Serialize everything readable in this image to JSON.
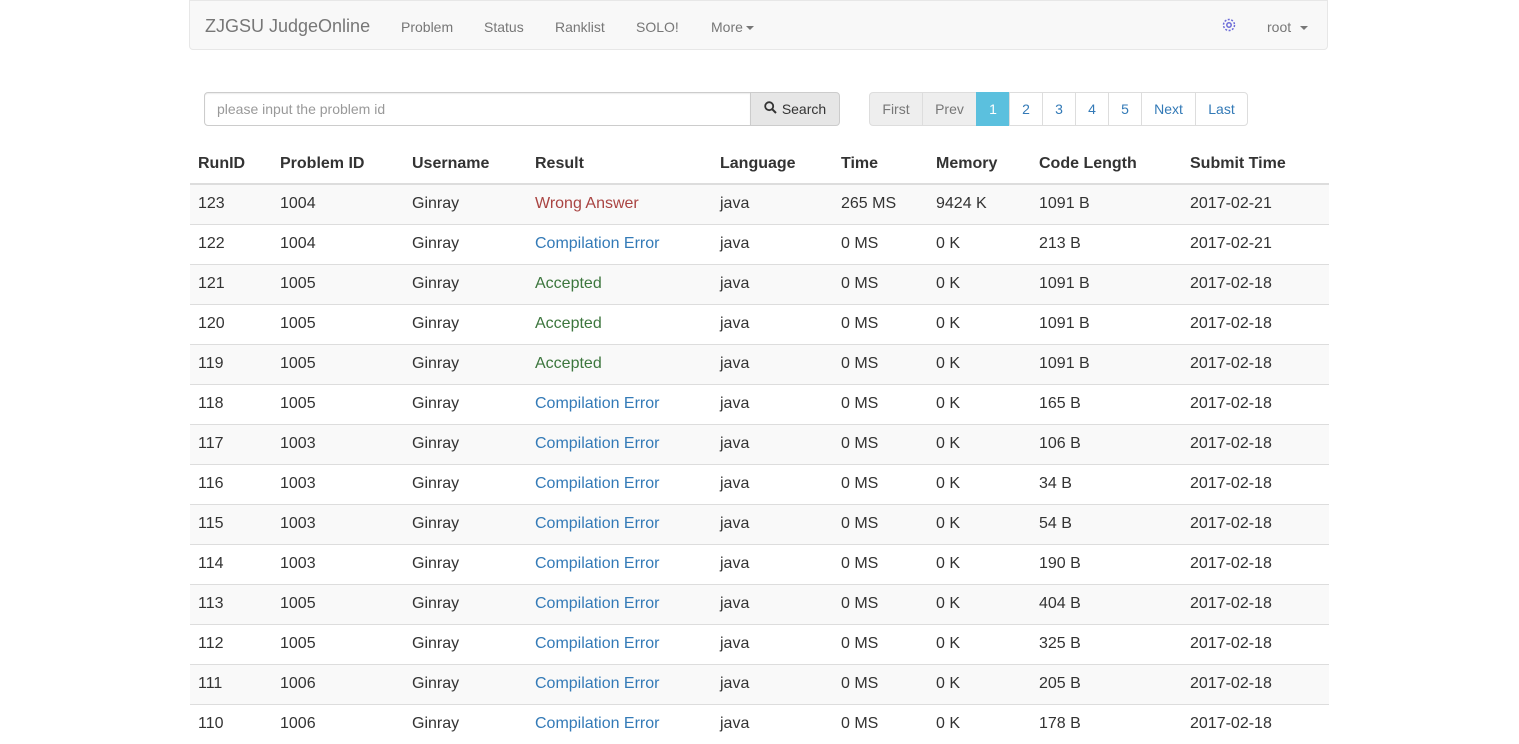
{
  "navbar": {
    "brand": "ZJGSU JudgeOnline",
    "links": [
      "Problem",
      "Status",
      "Ranklist",
      "SOLO!",
      "More"
    ],
    "user": "root",
    "gear_icon": "gear-icon"
  },
  "search": {
    "placeholder": "please input the problem id",
    "value": "",
    "button_label": "Search",
    "icon": "search-icon"
  },
  "pagination": [
    "First",
    "Prev",
    "1",
    "2",
    "3",
    "4",
    "5",
    "Next",
    "Last"
  ],
  "pagination_active": "1",
  "table": {
    "headers": [
      "RunID",
      "Problem ID",
      "Username",
      "Result",
      "Language",
      "Time",
      "Memory",
      "Code Length",
      "Submit Time"
    ],
    "rows": [
      [
        "123",
        "1004",
        "Ginray",
        "Wrong Answer",
        "java",
        "265 MS",
        "9424 K",
        "1091 B",
        "2017-02-21"
      ],
      [
        "122",
        "1004",
        "Ginray",
        "Compilation Error",
        "java",
        "0 MS",
        "0 K",
        "213 B",
        "2017-02-21"
      ],
      [
        "121",
        "1005",
        "Ginray",
        "Accepted",
        "java",
        "0 MS",
        "0 K",
        "1091 B",
        "2017-02-18"
      ],
      [
        "120",
        "1005",
        "Ginray",
        "Accepted",
        "java",
        "0 MS",
        "0 K",
        "1091 B",
        "2017-02-18"
      ],
      [
        "119",
        "1005",
        "Ginray",
        "Accepted",
        "java",
        "0 MS",
        "0 K",
        "1091 B",
        "2017-02-18"
      ],
      [
        "118",
        "1005",
        "Ginray",
        "Compilation Error",
        "java",
        "0 MS",
        "0 K",
        "165 B",
        "2017-02-18"
      ],
      [
        "117",
        "1003",
        "Ginray",
        "Compilation Error",
        "java",
        "0 MS",
        "0 K",
        "106 B",
        "2017-02-18"
      ],
      [
        "116",
        "1003",
        "Ginray",
        "Compilation Error",
        "java",
        "0 MS",
        "0 K",
        "34 B",
        "2017-02-18"
      ],
      [
        "115",
        "1003",
        "Ginray",
        "Compilation Error",
        "java",
        "0 MS",
        "0 K",
        "54 B",
        "2017-02-18"
      ],
      [
        "114",
        "1003",
        "Ginray",
        "Compilation Error",
        "java",
        "0 MS",
        "0 K",
        "190 B",
        "2017-02-18"
      ],
      [
        "113",
        "1005",
        "Ginray",
        "Compilation Error",
        "java",
        "0 MS",
        "0 K",
        "404 B",
        "2017-02-18"
      ],
      [
        "112",
        "1005",
        "Ginray",
        "Compilation Error",
        "java",
        "0 MS",
        "0 K",
        "325 B",
        "2017-02-18"
      ],
      [
        "111",
        "1006",
        "Ginray",
        "Compilation Error",
        "java",
        "0 MS",
        "0 K",
        "205 B",
        "2017-02-18"
      ],
      [
        "110",
        "1006",
        "Ginray",
        "Compilation Error",
        "java",
        "0 MS",
        "0 K",
        "178 B",
        "2017-02-18"
      ]
    ]
  },
  "result_colors": {
    "Wrong Answer": "#a94442",
    "Compilation Error": "#337ab7",
    "Accepted": "#3c763d"
  }
}
